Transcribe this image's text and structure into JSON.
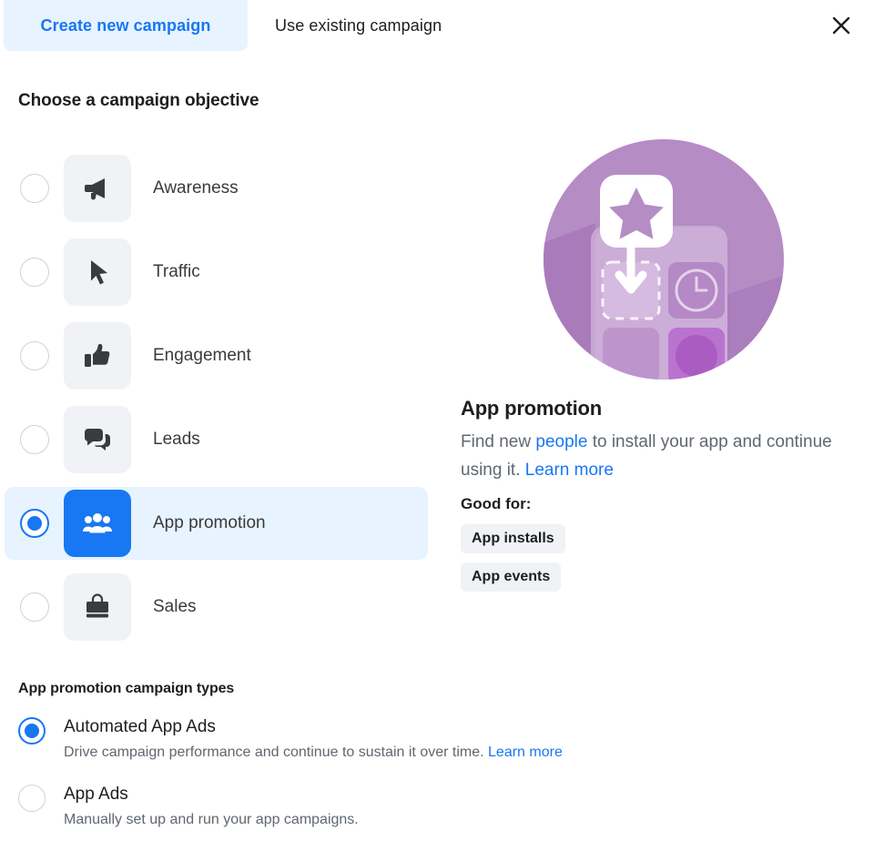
{
  "tabs": {
    "create_label": "Create new campaign",
    "existing_label": "Use existing campaign",
    "close_icon": "close-icon",
    "active_tab": "Create new campaign",
    "active_color": "#1877f2",
    "active_bg": "#e7f3ff"
  },
  "objective_section": {
    "heading": "Choose a campaign objective",
    "items": [
      {
        "label": "Awareness",
        "icon": "megaphone-icon",
        "selected": false
      },
      {
        "label": "Traffic",
        "icon": "cursor-icon",
        "selected": false
      },
      {
        "label": "Engagement",
        "icon": "thumbs-up-icon",
        "selected": false
      },
      {
        "label": "Leads",
        "icon": "speech-bubble-icon",
        "selected": false
      },
      {
        "label": "App promotion",
        "icon": "people-group-icon",
        "selected": true
      },
      {
        "label": "Sales",
        "icon": "shopping-bag-icon",
        "selected": false
      }
    ]
  },
  "detail": {
    "illustration": "app-promotion-illustration",
    "title": "App promotion",
    "desc_part1": "Find new ",
    "desc_link1": "people",
    "desc_part2": " to install your app and continue using it. ",
    "desc_link2": "Learn more",
    "good_for_label": "Good for:",
    "chips": [
      "App installs",
      "App events"
    ]
  },
  "campaign_types": {
    "heading": "App promotion campaign types",
    "options": [
      {
        "title": "Automated App Ads",
        "subtitle": "Drive campaign performance and continue to sustain it over time. ",
        "link": "Learn more",
        "selected": true
      },
      {
        "title": "App Ads",
        "subtitle": "Manually set up and run your app campaigns.",
        "link": "",
        "selected": false
      }
    ]
  },
  "colors": {
    "brand_blue": "#1877f2",
    "light_blue": "#e7f3ff",
    "tile_gray": "#f0f2f5",
    "text_primary": "#1c1e21",
    "text_secondary": "#606770",
    "illustration_purple": "#b58cc4"
  }
}
